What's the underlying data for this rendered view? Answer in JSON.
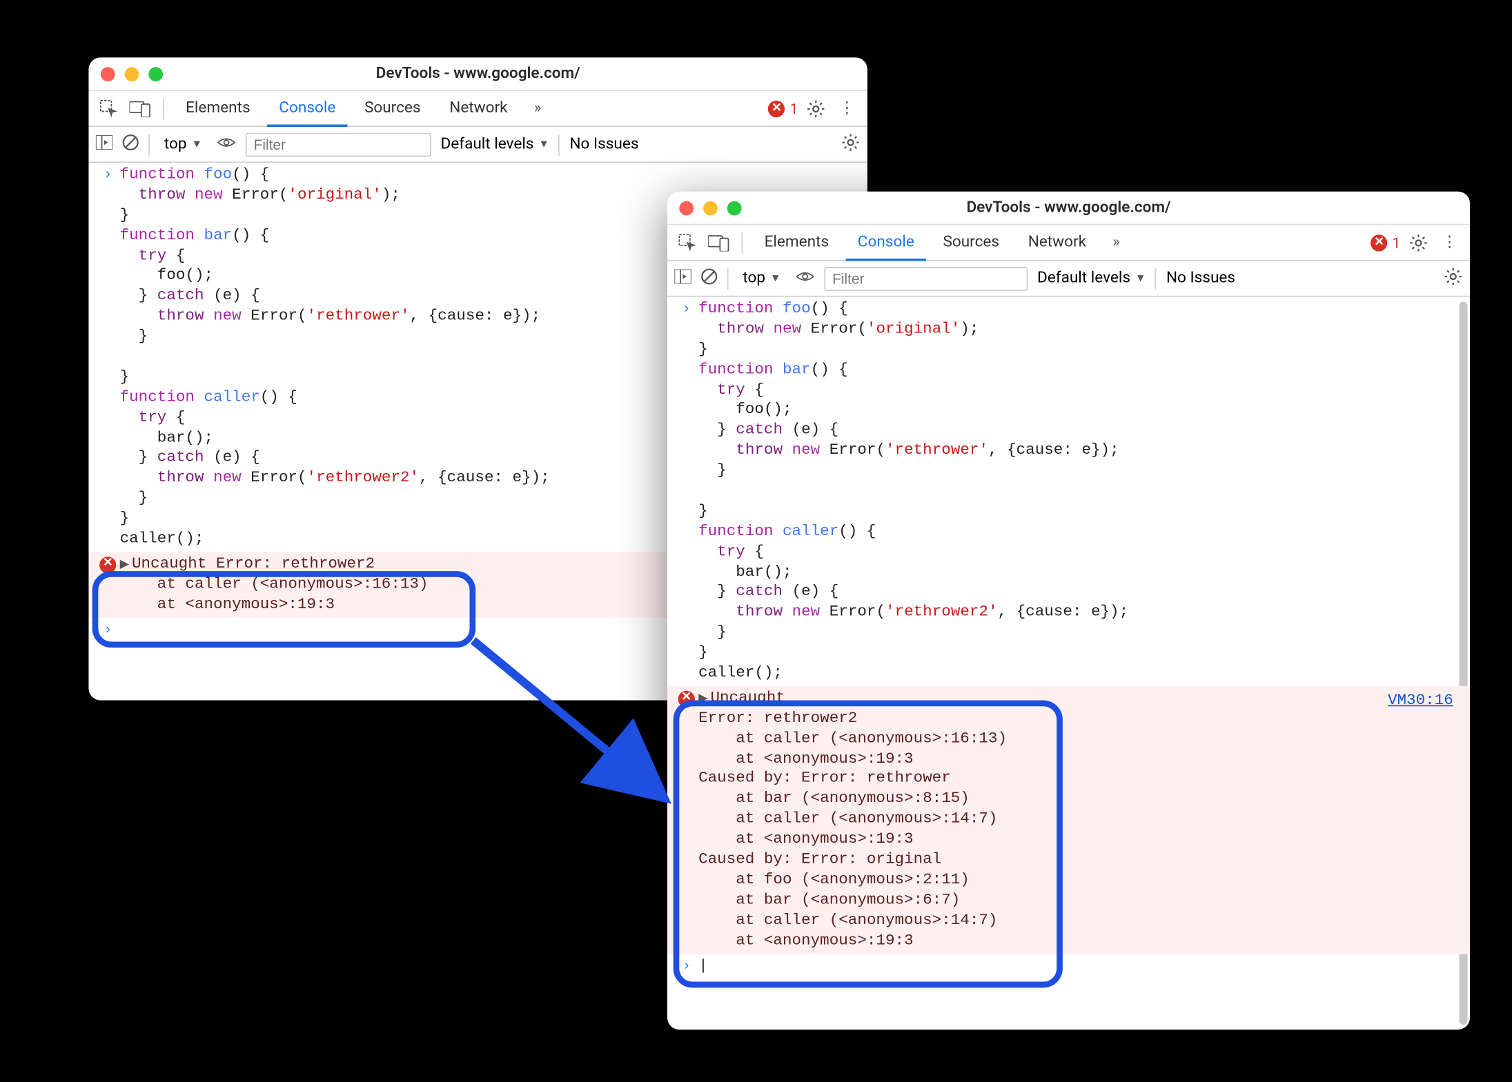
{
  "windows": {
    "title": "DevTools - www.google.com/"
  },
  "tabs": {
    "elements": "Elements",
    "console": "Console",
    "sources": "Sources",
    "network": "Network",
    "error_count": "1"
  },
  "toolbar": {
    "context": "top",
    "filter_placeholder": "Filter",
    "levels": "Default levels",
    "issues": "No Issues"
  },
  "code": {
    "line1": "function foo() {",
    "line2": "  throw new Error('original');",
    "line3": "}",
    "line4": "function bar() {",
    "line5": "  try {",
    "line6": "    foo();",
    "line7": "  } catch (e) {",
    "line8": "    throw new Error('rethrower', {cause: e});",
    "line9": "  }",
    "line10": "",
    "line11": "}",
    "line12": "function caller() {",
    "line13": "  try {",
    "line14": "    bar();",
    "line15": "  } catch (e) {",
    "line16": "    throw new Error('rethrower2', {cause: e});",
    "line17": "  }",
    "line18": "}",
    "line19": "caller();"
  },
  "error_w1": {
    "header": "Uncaught Error: rethrower2",
    "stack1": "    at caller (<anonymous>:16:13)",
    "stack2": "    at <anonymous>:19:3"
  },
  "error_w2": {
    "header": "Uncaught",
    "link": "VM30:16",
    "l1": "Error: rethrower2",
    "l2": "    at caller (<anonymous>:16:13)",
    "l3": "    at <anonymous>:19:3",
    "l4": "Caused by: Error: rethrower",
    "l5": "    at bar (<anonymous>:8:15)",
    "l6": "    at caller (<anonymous>:14:7)",
    "l7": "    at <anonymous>:19:3",
    "l8": "Caused by: Error: original",
    "l9": "    at foo (<anonymous>:2:11)",
    "l10": "    at bar (<anonymous>:6:7)",
    "l11": "    at caller (<anonymous>:14:7)",
    "l12": "    at <anonymous>:19:3"
  }
}
